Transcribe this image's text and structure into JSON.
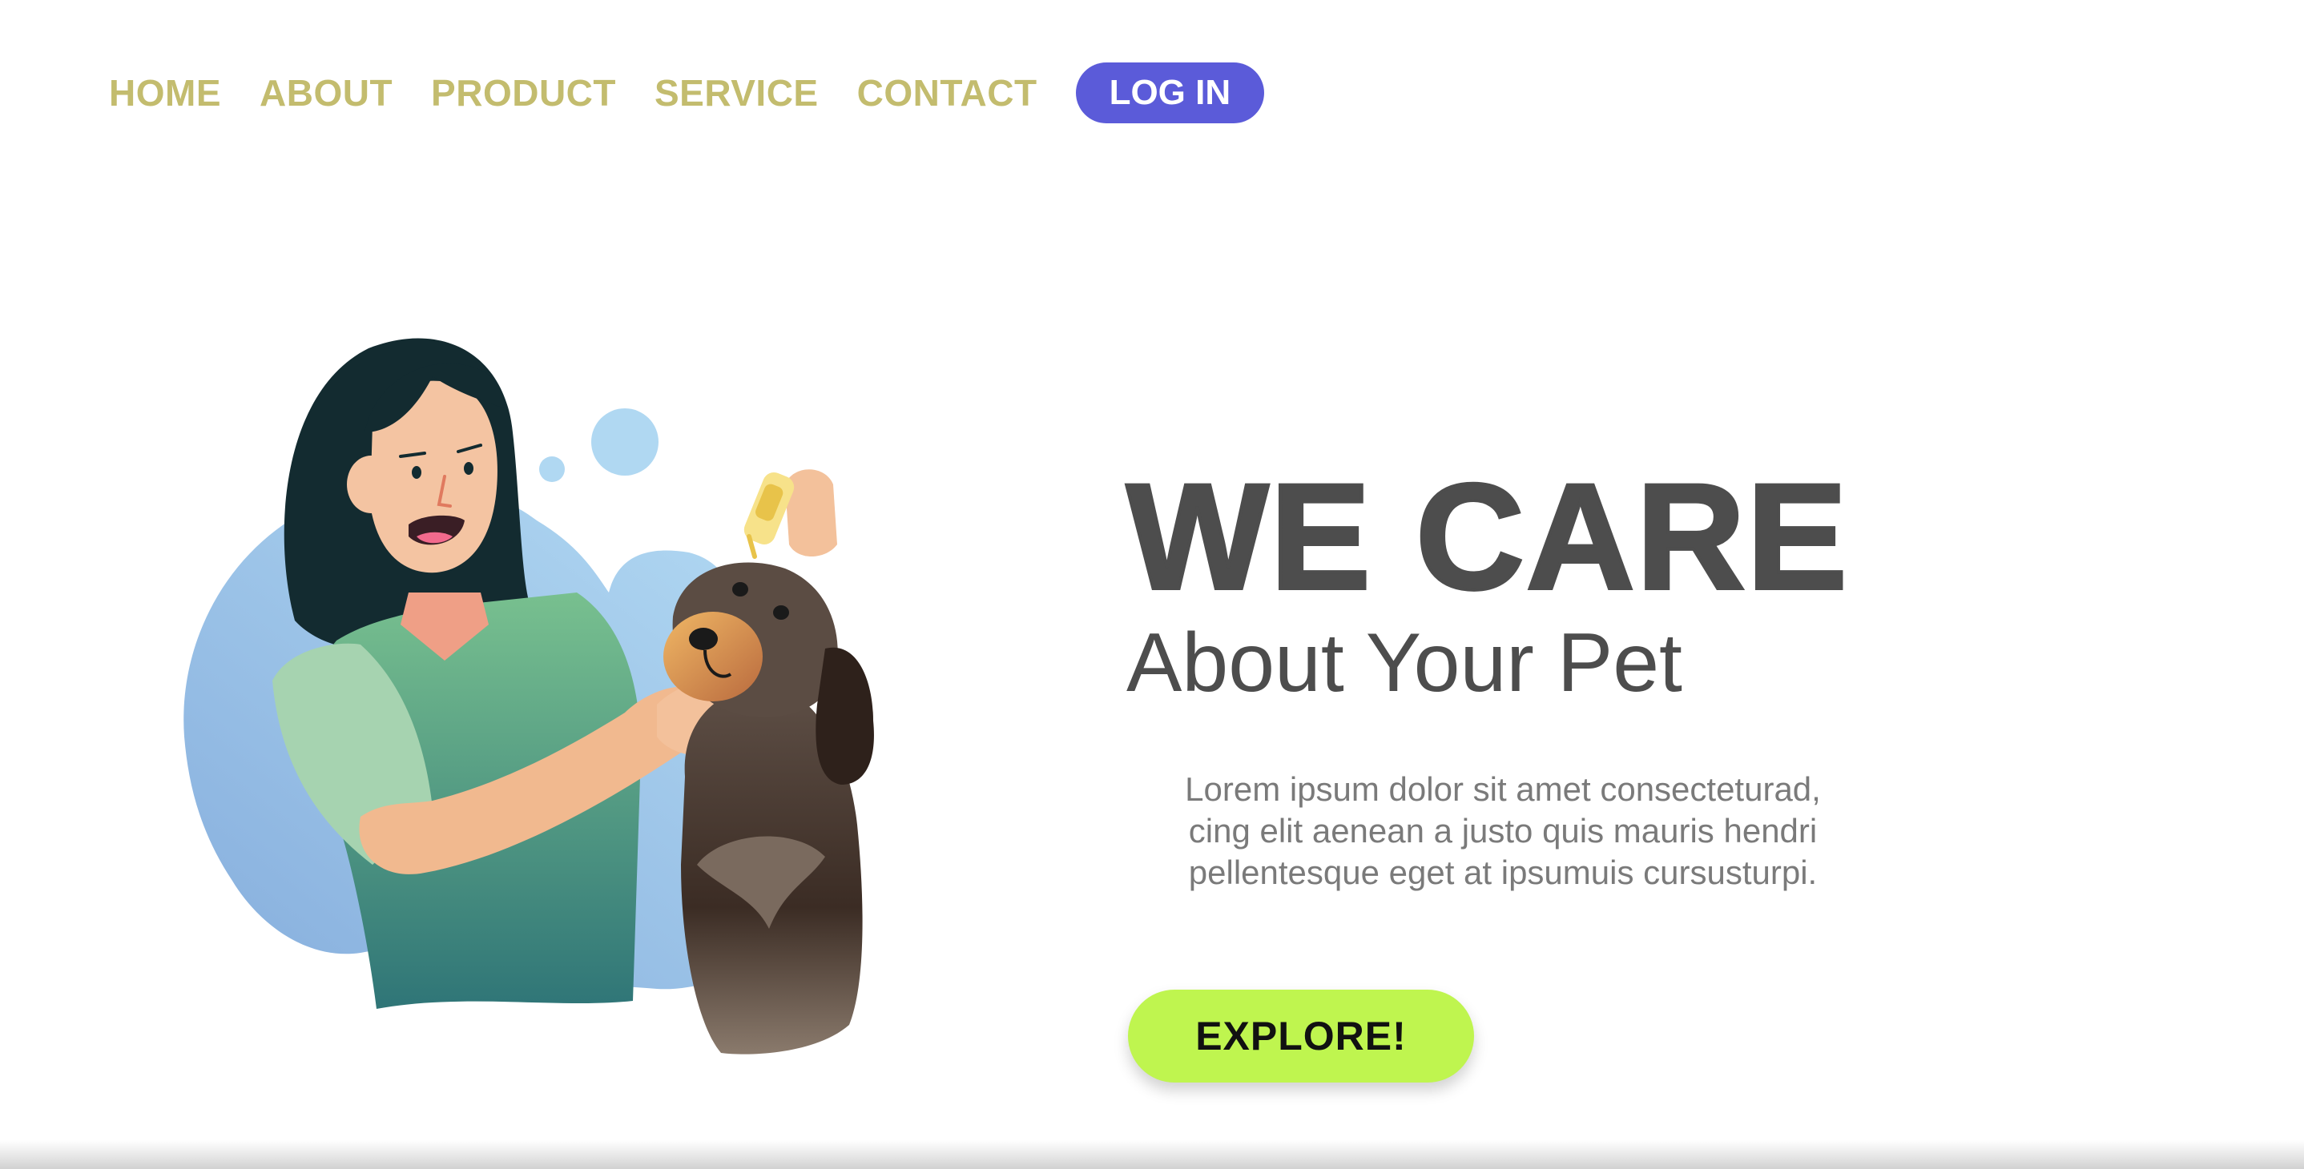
{
  "nav": {
    "items": [
      {
        "label": "HOME"
      },
      {
        "label": "ABOUT"
      },
      {
        "label": "PRODUCT"
      },
      {
        "label": "SERVICE"
      },
      {
        "label": "CONTACT"
      }
    ],
    "login_label": "LOG IN"
  },
  "hero": {
    "headline": "WE CARE",
    "subheadline": "About Your Pet",
    "description_lines": [
      "Lorem ipsum dolor sit amet consecteturad,",
      "cing elit aenean a justo quis mauris hendri",
      "pellentesque eget at ipsumuis cursusturpi."
    ],
    "cta_label": "EXPLORE!",
    "illustration": "woman-applying-ear-drops-to-dog-illustration"
  },
  "colors": {
    "nav_link": "#c3bc6e",
    "login_button": "#5b5bd9",
    "headline": "#4d4d4d",
    "body_text": "#7a7a7a",
    "cta_button": "#bff54f",
    "blob_blue": "#9dcbef"
  }
}
